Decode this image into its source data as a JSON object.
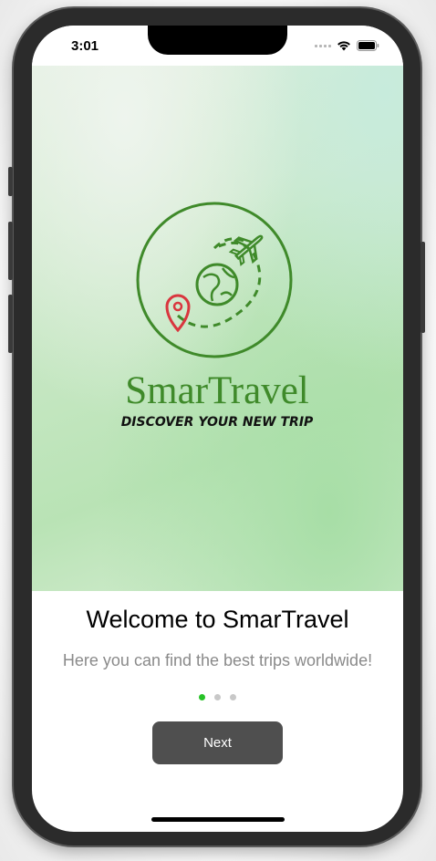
{
  "status_bar": {
    "time": "3:01",
    "signal_icon": "cellular-dots-icon",
    "wifi_icon": "wifi-icon",
    "battery_icon": "battery-icon"
  },
  "logo": {
    "icon": "travel-globe-plane-pin-icon",
    "brand_text": "SmarTravel",
    "tagline": "DISCOVER YOUR NEW TRIP",
    "colors": {
      "green": "#3f8a2a",
      "pin_red": "#d9363e",
      "tagline_black": "#111111"
    }
  },
  "onboarding": {
    "title": "Welcome to SmarTravel",
    "subtitle": "Here you can find the best trips worldwide!",
    "page_indicator": {
      "total": 3,
      "active_index": 0
    },
    "next_label": "Next"
  },
  "colors": {
    "active_dot": "#27c227",
    "inactive_dot": "#c8c8c8",
    "button_bg": "#4f4f4f",
    "subtitle_text": "#8a8a8a"
  }
}
